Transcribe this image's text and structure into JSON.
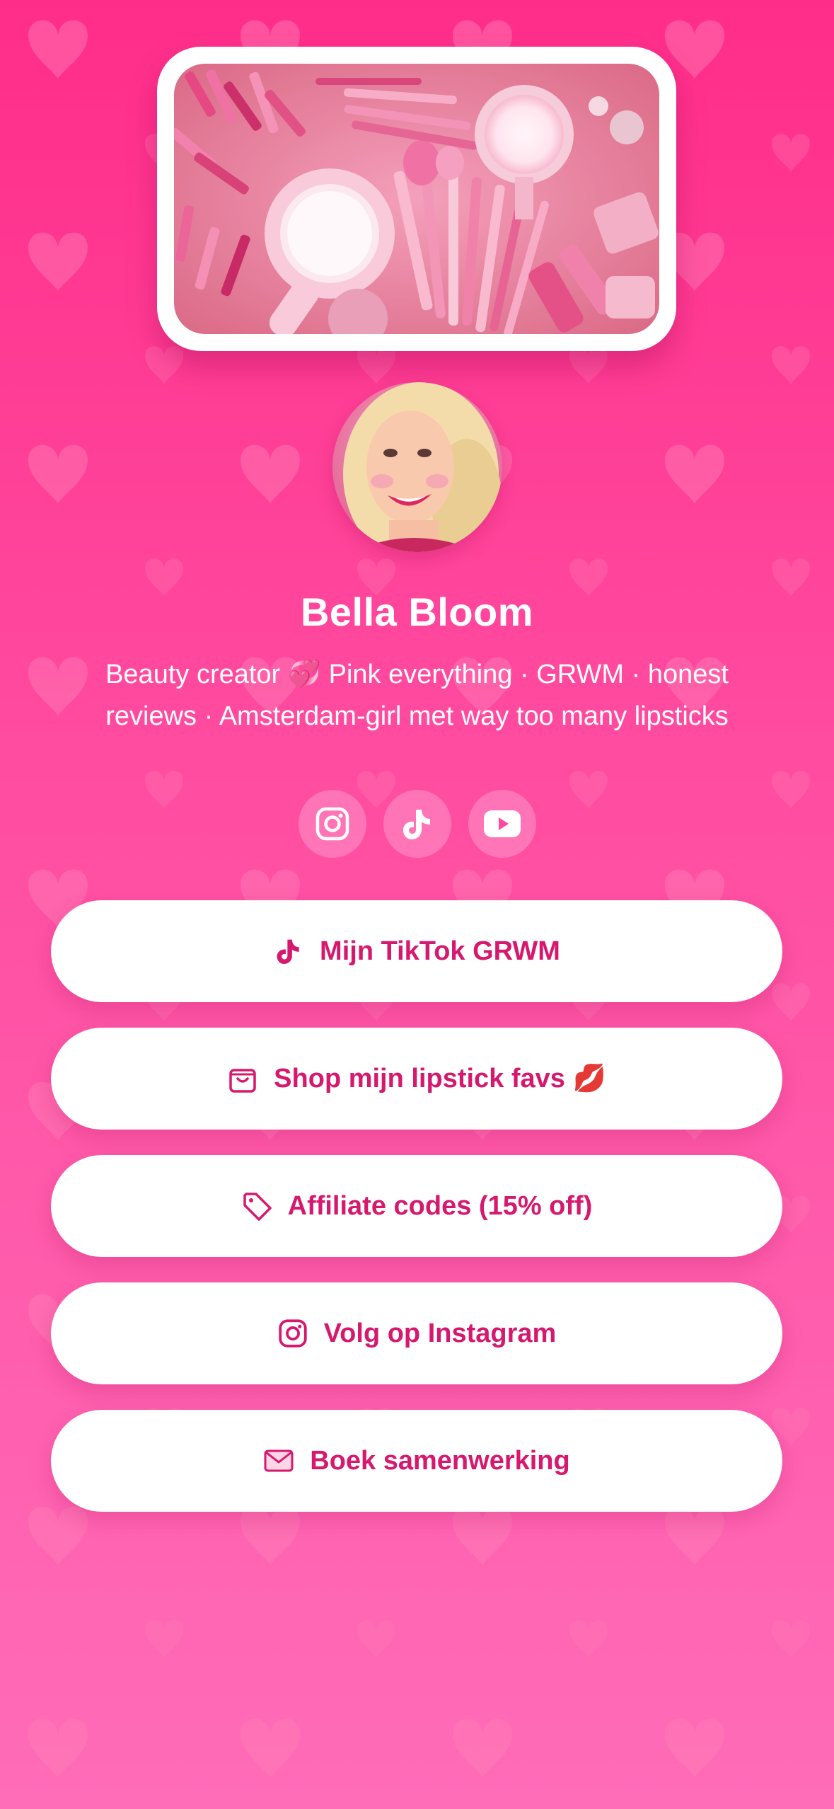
{
  "profile": {
    "name": "Bella Bloom",
    "bio_line1": "Beauty creator 💞  Pink everything · GRWM · honest",
    "bio_line2": "reviews · Amsterdam-girl met way too many lipsticks"
  },
  "socials": [
    {
      "icon": "instagram-icon"
    },
    {
      "icon": "tiktok-icon"
    },
    {
      "icon": "youtube-icon"
    }
  ],
  "links": [
    {
      "label": "Mijn TikTok GRWM",
      "icon": "tiktok-icon"
    },
    {
      "label": "Shop mijn lipstick favs 💋",
      "icon": "shopping-bag-icon"
    },
    {
      "label": "Affiliate codes (15% off)",
      "icon": "tag-icon"
    },
    {
      "label": "Volg op Instagram",
      "icon": "instagram-icon"
    },
    {
      "label": "Boek samenwerking",
      "icon": "mail-icon"
    }
  ],
  "colors": {
    "accent": "#d6186e",
    "background_top": "#ff2d8a",
    "background_bottom": "#ff6cb8",
    "button": "#ffffff"
  }
}
